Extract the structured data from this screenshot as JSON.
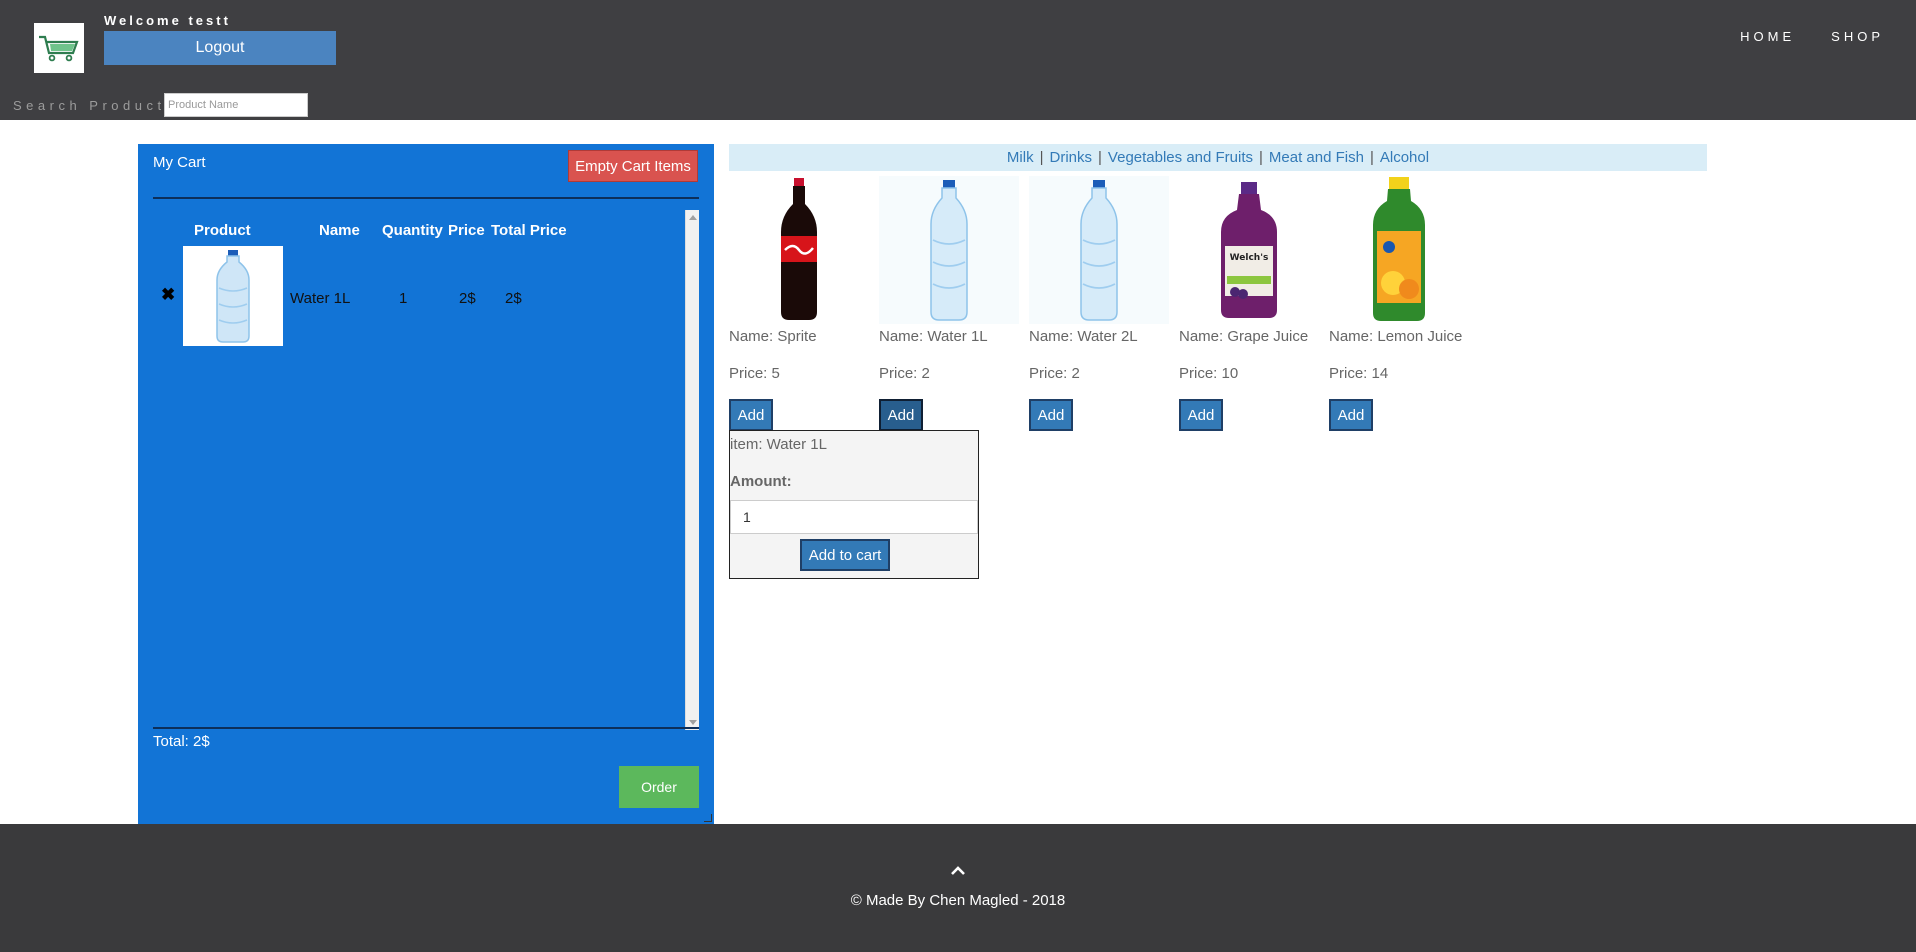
{
  "header": {
    "welcome": "Welcome testt",
    "logout_label": "Logout",
    "logo_icon": "shopping-cart-icon",
    "nav": [
      "HOME",
      "SHOP"
    ],
    "search_label": "Search Products",
    "search_placeholder": "Product Name",
    "search_value": ""
  },
  "cart": {
    "title": "My Cart",
    "empty_label": "Empty Cart Items",
    "columns": [
      "Product",
      "Name",
      "Quantity",
      "Price",
      "Total Price"
    ],
    "rows": [
      {
        "image": "water-bottle-image",
        "name": "Water 1L",
        "quantity": "1",
        "price": "2$",
        "total": "2$"
      }
    ],
    "total_text": "Total: 2$",
    "order_label": "Order",
    "colors": {
      "background": "#1274d6",
      "empty_button": "#d9534f",
      "order_button": "#5cb85c"
    }
  },
  "categories": [
    "Milk",
    "Drinks",
    "Vegetables and Fruits",
    "Meat and Fish",
    "Alcohol"
  ],
  "products": [
    {
      "name": "Name: Sprite",
      "price": "Price: 5",
      "add_label": "Add",
      "image": "cola-bottle-image"
    },
    {
      "name": "Name: Water 1L",
      "price": "Price: 2",
      "add_label": "Add",
      "image": "water-bottle-image"
    },
    {
      "name": "Name: Water 2L",
      "price": "Price: 2",
      "add_label": "Add",
      "image": "water-bottle-image"
    },
    {
      "name": "Name: Grape Juice",
      "price": "Price: 10",
      "add_label": "Add",
      "image": "grape-juice-image"
    },
    {
      "name": "Name: Lemon Juice",
      "price": "Price: 14",
      "add_label": "Add",
      "image": "lemon-juice-image"
    }
  ],
  "popover": {
    "item_text": "item: Water 1L",
    "amount_label": "Amount:",
    "amount_value": "1",
    "add_to_cart_label": "Add to cart"
  },
  "footer": {
    "up_icon": "chevron-up-icon",
    "copyright": "© Made By Chen Magled - 2018"
  }
}
